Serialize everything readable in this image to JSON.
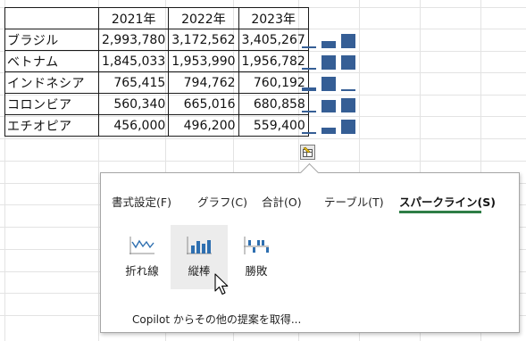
{
  "table": {
    "headers": [
      "",
      "2021年",
      "2022年",
      "2023年"
    ],
    "rows": [
      {
        "name": "ブラジル",
        "values": [
          "2,993,780",
          "3,172,562",
          "3,405,267"
        ]
      },
      {
        "name": "ベトナム",
        "values": [
          "1,845,033",
          "1,953,990",
          "1,956,782"
        ]
      },
      {
        "name": "インドネシア",
        "values": [
          "765,415",
          "794,762",
          "760,192"
        ]
      },
      {
        "name": "コロンビア",
        "values": [
          "560,340",
          "665,016",
          "680,858"
        ]
      },
      {
        "name": "エチオピア",
        "values": [
          "456,000",
          "496,200",
          "559,400"
        ]
      }
    ]
  },
  "sparklines": {
    "type": "column",
    "color": "#355e95",
    "rows": [
      [
        2993780,
        3172562,
        3405267
      ],
      [
        1845033,
        1953990,
        1956782
      ],
      [
        765415,
        794762,
        760192
      ],
      [
        560340,
        665016,
        680858
      ],
      [
        456000,
        496200,
        559400
      ]
    ]
  },
  "quick_analysis": {
    "button_icon": "quick-analysis-icon",
    "tabs": [
      {
        "label": "書式設定(F)",
        "active": false
      },
      {
        "label": "グラフ(C)",
        "active": false
      },
      {
        "label": "合計(O)",
        "active": false
      },
      {
        "label": "テーブル(T)",
        "active": false
      },
      {
        "label": "スパークライン(S)",
        "active": true
      }
    ],
    "active_tab_color": "#2e7d46",
    "options": [
      {
        "label": "折れ線",
        "icon": "line-sparkline-icon",
        "hover": false
      },
      {
        "label": "縦棒",
        "icon": "column-sparkline-icon",
        "hover": true
      },
      {
        "label": "勝敗",
        "icon": "win-loss-sparkline-icon",
        "hover": false
      }
    ],
    "footer_link": "Copilot からその他の提案を取得..."
  }
}
